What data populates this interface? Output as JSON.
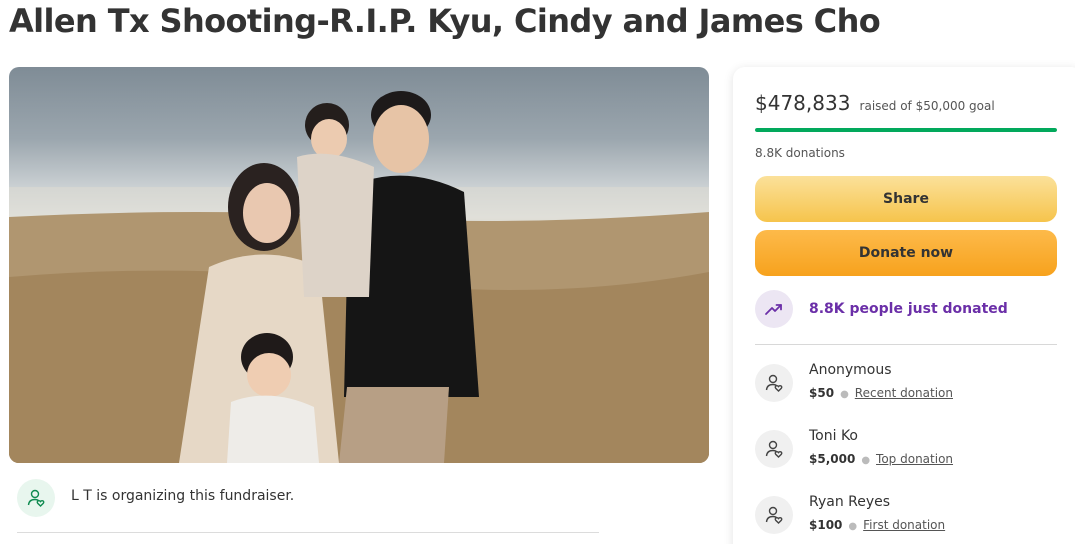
{
  "page": {
    "title": "Allen Tx Shooting-R.I.P. Kyu, Cindy and James Cho"
  },
  "organizer": {
    "text": "L T is organizing this fundraiser.",
    "icon": "person-heart-icon"
  },
  "fundraiser": {
    "raised_amount": "$478,833",
    "goal_text": "raised of $50,000 goal",
    "progress_fraction": 1.0,
    "donation_count": "8.8K donations",
    "share_label": "Share",
    "donate_label": "Donate now",
    "trend_text": "8.8K people just donated",
    "trend_icon": "trending-up-icon"
  },
  "donors": [
    {
      "name": "Anonymous",
      "amount": "$50",
      "tag": "Recent donation"
    },
    {
      "name": "Toni Ko",
      "amount": "$5,000",
      "tag": "Top donation"
    },
    {
      "name": "Ryan Reyes",
      "amount": "$100",
      "tag": "First donation"
    }
  ],
  "colors": {
    "progress": "#02a95c",
    "share_button": "#f6c44c",
    "donate_button": "#f7a21d",
    "trend_text": "#6b2fa8"
  }
}
